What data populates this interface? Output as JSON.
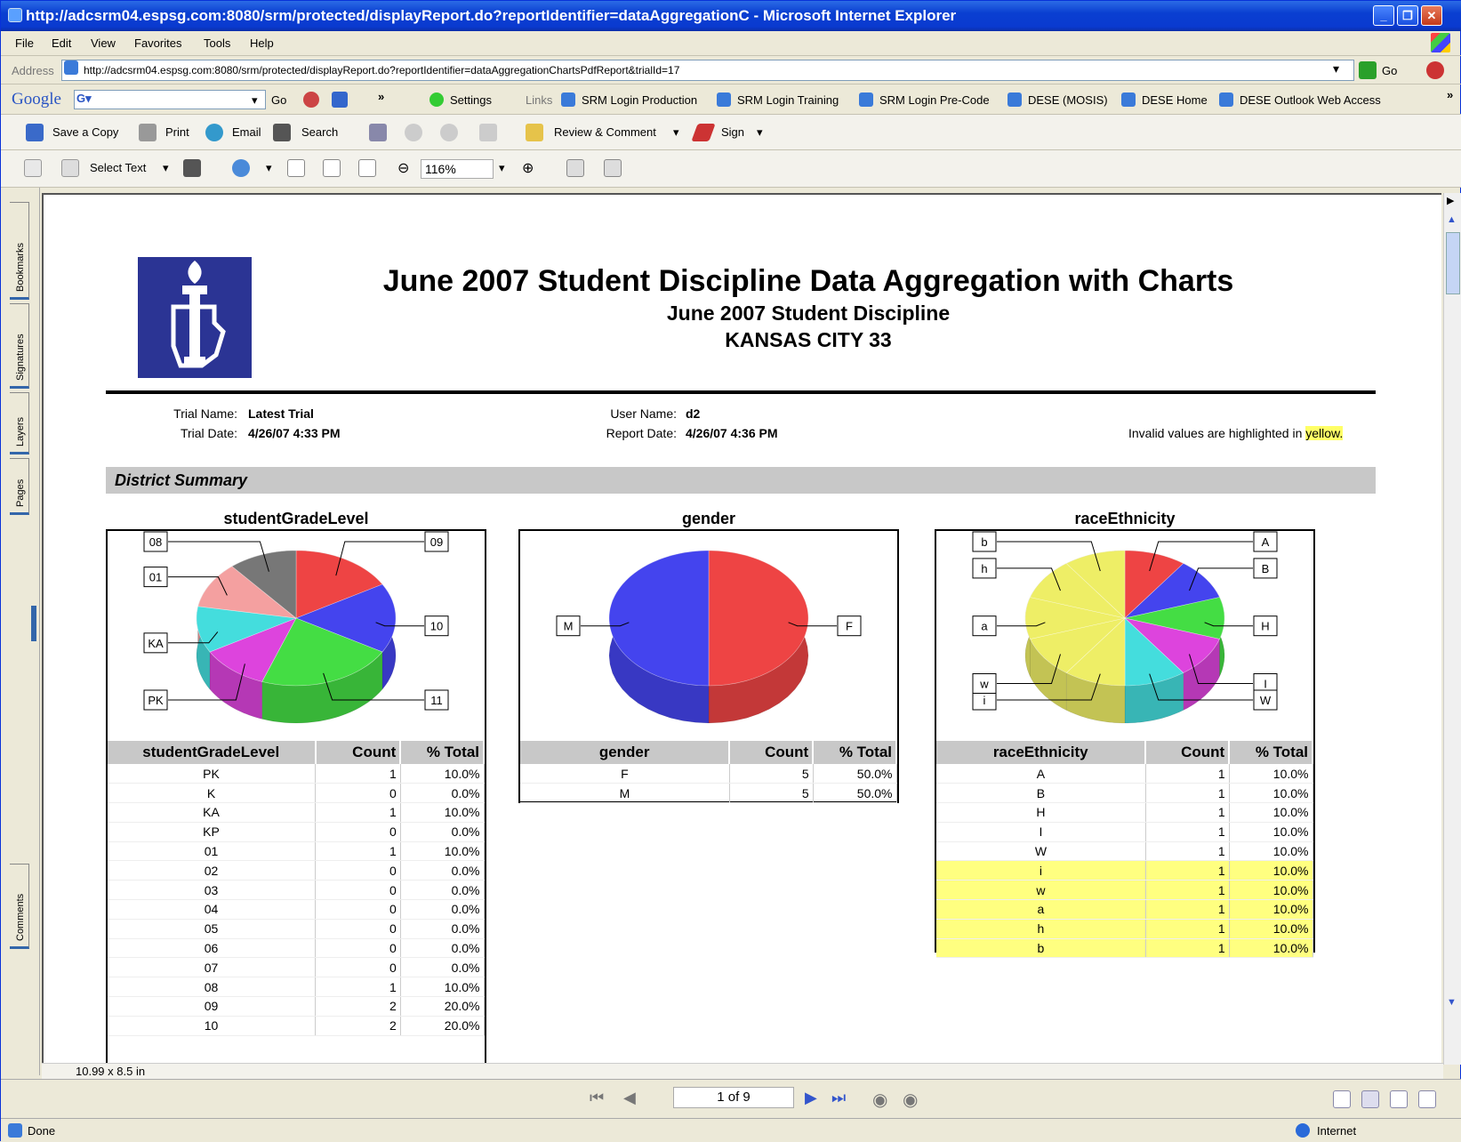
{
  "window": {
    "title": "http://adcsrm04.espsg.com:8080/srm/protected/displayReport.do?reportIdentifier=dataAggregationC - Microsoft Internet Explorer",
    "controls": [
      "_",
      "❐",
      "✕"
    ]
  },
  "menu": [
    "File",
    "Edit",
    "View",
    "Favorites",
    "Tools",
    "Help"
  ],
  "address": {
    "label": "Address",
    "url": "http://adcsrm04.espsg.com:8080/srm/protected/displayReport.do?reportIdentifier=dataAggregationChartsPdfReport&trialId=17",
    "go_label": "Go"
  },
  "google_bar": {
    "brand": "Google",
    "go_label": "Go",
    "settings_label": "Settings",
    "links_label": "Links",
    "links": [
      "SRM Login Production",
      "SRM Login Training",
      "SRM Login Pre-Code",
      "DESE (MOSIS)",
      "DESE Home",
      "DESE Outlook Web Access"
    ]
  },
  "pdf_toolbar1": {
    "save_copy": "Save a Copy",
    "print": "Print",
    "email": "Email",
    "search": "Search",
    "review": "Review & Comment",
    "sign": "Sign"
  },
  "pdf_toolbar2": {
    "select_text": "Select Text",
    "zoom": "116%"
  },
  "side_tabs": [
    "Bookmarks",
    "Signatures",
    "Layers",
    "Pages",
    "Comments"
  ],
  "report": {
    "title": "June 2007 Student Discipline Data Aggregation with Charts",
    "subtitle": "June 2007 Student Discipline",
    "district": "KANSAS CITY 33",
    "trial_name_label": "Trial Name:",
    "trial_name": "Latest Trial",
    "trial_date_label": "Trial Date:",
    "trial_date": "4/26/07 4:33 PM",
    "user_name_label": "User Name:",
    "user_name": "d2",
    "report_date_label": "Report Date:",
    "report_date": "4/26/07 4:36 PM",
    "invalid_note": "Invalid values are highlighted in",
    "invalid_word": "yellow.",
    "section": "District Summary"
  },
  "tables": {
    "grade": {
      "headers": [
        "studentGradeLevel",
        "Count",
        "% Total"
      ],
      "rows": [
        [
          "PK",
          "1",
          "10.0%"
        ],
        [
          "K",
          "0",
          "0.0%"
        ],
        [
          "KA",
          "1",
          "10.0%"
        ],
        [
          "KP",
          "0",
          "0.0%"
        ],
        [
          "01",
          "1",
          "10.0%"
        ],
        [
          "02",
          "0",
          "0.0%"
        ],
        [
          "03",
          "0",
          "0.0%"
        ],
        [
          "04",
          "0",
          "0.0%"
        ],
        [
          "05",
          "0",
          "0.0%"
        ],
        [
          "06",
          "0",
          "0.0%"
        ],
        [
          "07",
          "0",
          "0.0%"
        ],
        [
          "08",
          "1",
          "10.0%"
        ],
        [
          "09",
          "2",
          "20.0%"
        ],
        [
          "10",
          "2",
          "20.0%"
        ]
      ]
    },
    "gender": {
      "headers": [
        "gender",
        "Count",
        "% Total"
      ],
      "rows": [
        [
          "F",
          "5",
          "50.0%"
        ],
        [
          "M",
          "5",
          "50.0%"
        ]
      ]
    },
    "race": {
      "headers": [
        "raceEthnicity",
        "Count",
        "% Total"
      ],
      "rows": [
        [
          "A",
          "1",
          "10.0%"
        ],
        [
          "B",
          "1",
          "10.0%"
        ],
        [
          "H",
          "1",
          "10.0%"
        ],
        [
          "I",
          "1",
          "10.0%"
        ],
        [
          "W",
          "1",
          "10.0%"
        ],
        [
          "i",
          "1",
          "10.0%"
        ],
        [
          "w",
          "1",
          "10.0%"
        ],
        [
          "a",
          "1",
          "10.0%"
        ],
        [
          "h",
          "1",
          "10.0%"
        ],
        [
          "b",
          "1",
          "10.0%"
        ]
      ],
      "invalid_from_index": 5
    }
  },
  "chart_data": [
    {
      "type": "pie",
      "title": "studentGradeLevel",
      "categories": [
        "09",
        "10",
        "11",
        "PK",
        "KA",
        "01",
        "08"
      ],
      "values": [
        1.5,
        1.5,
        2,
        1,
        1,
        1,
        1
      ],
      "colors": [
        "#ee4444",
        "#4444ee",
        "#44dd44",
        "#dd44dd",
        "#44dddd",
        "#f4a0a0",
        "#777777"
      ]
    },
    {
      "type": "pie",
      "title": "gender",
      "categories": [
        "F",
        "M"
      ],
      "values": [
        5,
        5
      ],
      "colors": [
        "#ee4444",
        "#4444ee"
      ]
    },
    {
      "type": "pie",
      "title": "raceEthnicity",
      "categories": [
        "A",
        "B",
        "H",
        "I",
        "W",
        "i",
        "w",
        "a",
        "h",
        "b"
      ],
      "values": [
        1,
        1,
        1,
        1,
        1,
        1,
        1,
        1,
        1,
        1
      ],
      "colors": [
        "#ee4444",
        "#4444ee",
        "#44dd44",
        "#dd44dd",
        "#44dddd",
        "#eeee66",
        "#eeee66",
        "#eeee66",
        "#eeee66",
        "#eeee66"
      ]
    }
  ],
  "nav": {
    "page": "1 of 9",
    "page_size": "10.99 x 8.5 in"
  },
  "status": {
    "left": "Done",
    "zone": "Internet"
  }
}
